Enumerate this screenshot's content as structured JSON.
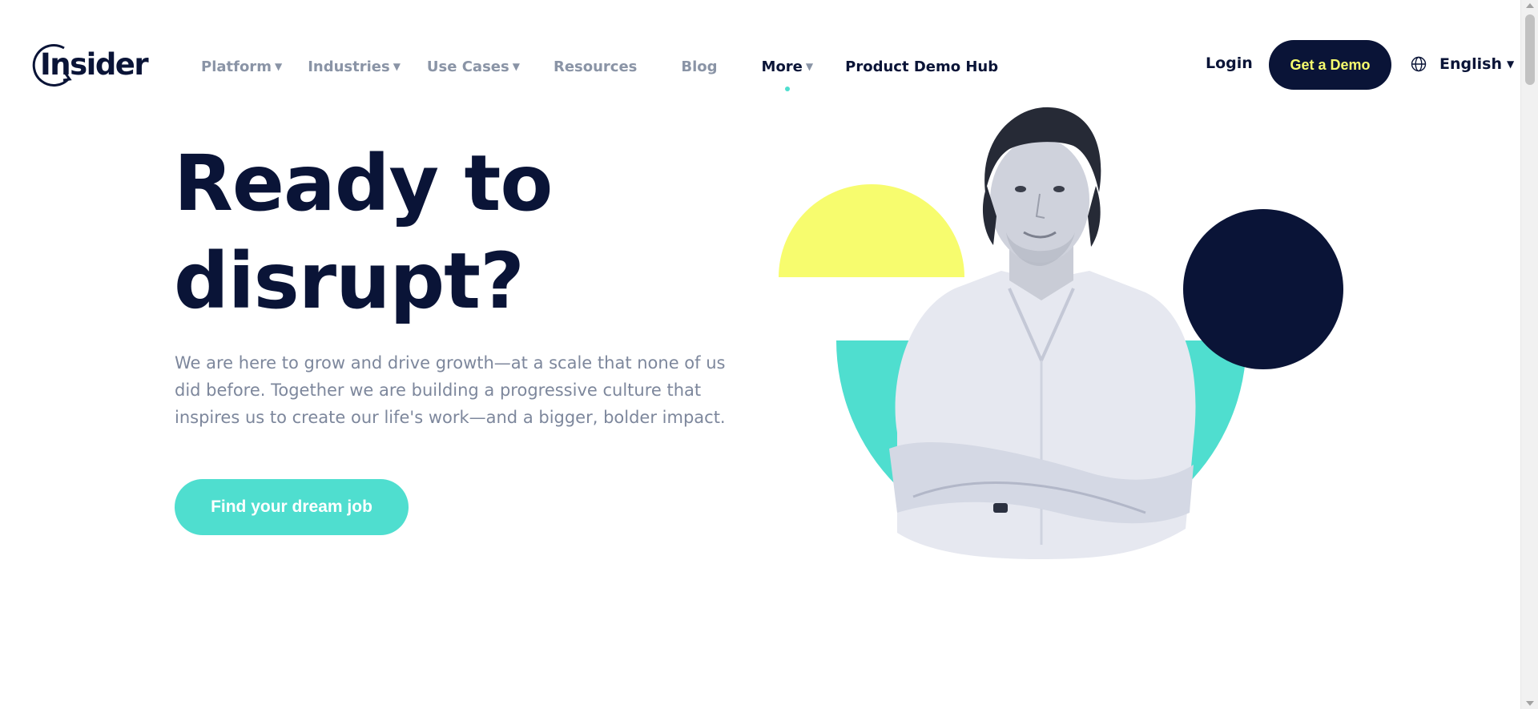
{
  "header": {
    "logo_text": "Insider",
    "nav": [
      {
        "label": "Platform",
        "has_dropdown": true
      },
      {
        "label": "Industries",
        "has_dropdown": true
      },
      {
        "label": "Use Cases",
        "has_dropdown": true
      },
      {
        "label": "Resources",
        "has_dropdown": false
      },
      {
        "label": "Blog",
        "has_dropdown": false
      },
      {
        "label": "More",
        "has_dropdown": true,
        "active": true
      },
      {
        "label": "Product Demo Hub",
        "has_dropdown": false
      }
    ],
    "login_label": "Login",
    "demo_label": "Get a Demo",
    "language_label": "English",
    "caret": "▼"
  },
  "hero": {
    "headline_line1": "Ready to",
    "headline_line2": "disrupt?",
    "subtext": "We are here to grow and drive growth—at a scale that none of us did before. Together we are building a progressive culture that inspires us to create our life's work—and a bigger, bolder impact.",
    "cta_label": "Find your dream job"
  },
  "colors": {
    "navy": "#0a1437",
    "teal": "#4fdecf",
    "yellow": "#f7fc6e",
    "muted_text": "#7d879c",
    "nav_gray": "#8a94a6"
  },
  "icons": [
    "insider-logo-icon",
    "globe-icon",
    "caret-down-icon"
  ]
}
